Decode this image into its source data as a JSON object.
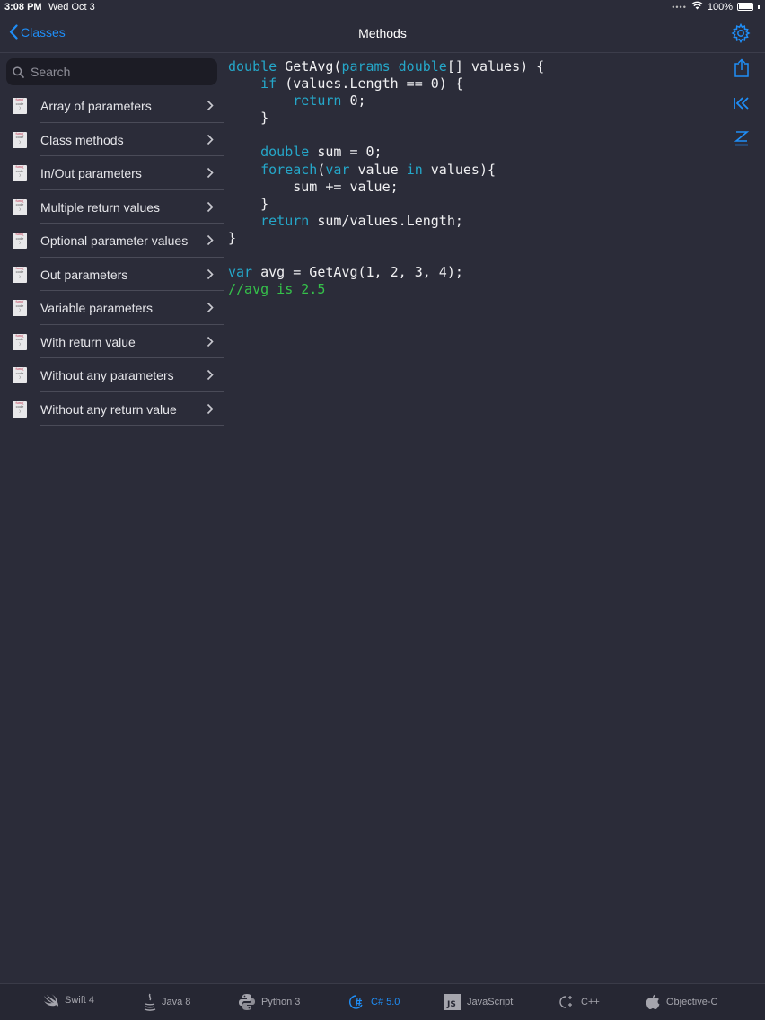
{
  "status": {
    "time": "3:08 PM",
    "date": "Wed Oct 3",
    "battery": "100%"
  },
  "nav": {
    "back_label": "Classes",
    "title": "Methods"
  },
  "search": {
    "placeholder": "Search"
  },
  "sidebar": {
    "items": [
      {
        "label": "Array of parameters"
      },
      {
        "label": "Class methods"
      },
      {
        "label": "In/Out parameters"
      },
      {
        "label": "Multiple return values"
      },
      {
        "label": "Optional parameter values"
      },
      {
        "label": "Out parameters"
      },
      {
        "label": "Variable parameters"
      },
      {
        "label": "With return value"
      },
      {
        "label": "Without any parameters"
      },
      {
        "label": "Without any return value"
      }
    ]
  },
  "file_icon_text": [
    "func(",
    "code",
    ")"
  ],
  "code": {
    "lines": [
      [
        {
          "t": "double",
          "k": "kw"
        },
        {
          "t": " GetAvg("
        },
        {
          "t": "params",
          "k": "kw"
        },
        {
          "t": " "
        },
        {
          "t": "double",
          "k": "kw"
        },
        {
          "t": "[] values) {"
        }
      ],
      [
        {
          "t": "    "
        },
        {
          "t": "if",
          "k": "kw"
        },
        {
          "t": " (values.Length == 0) {"
        }
      ],
      [
        {
          "t": "        "
        },
        {
          "t": "return",
          "k": "kw"
        },
        {
          "t": " 0;"
        }
      ],
      [
        {
          "t": "    }"
        }
      ],
      [
        {
          "t": ""
        }
      ],
      [
        {
          "t": "    "
        },
        {
          "t": "double",
          "k": "kw"
        },
        {
          "t": " sum = 0;"
        }
      ],
      [
        {
          "t": "    "
        },
        {
          "t": "foreach",
          "k": "kw"
        },
        {
          "t": "("
        },
        {
          "t": "var",
          "k": "kw"
        },
        {
          "t": " value "
        },
        {
          "t": "in",
          "k": "kw"
        },
        {
          "t": " values){"
        }
      ],
      [
        {
          "t": "        sum += value;"
        }
      ],
      [
        {
          "t": "    }"
        }
      ],
      [
        {
          "t": "    "
        },
        {
          "t": "return",
          "k": "kw"
        },
        {
          "t": " sum/values.Length;"
        }
      ],
      [
        {
          "t": "}"
        }
      ],
      [
        {
          "t": ""
        }
      ],
      [
        {
          "t": "var",
          "k": "kw"
        },
        {
          "t": " avg = GetAvg(1, 2, 3, 4);"
        }
      ],
      [
        {
          "t": "//avg is 2.5",
          "k": "cm"
        }
      ]
    ]
  },
  "tabs": [
    {
      "label": "Swift 4",
      "icon": "swift-icon"
    },
    {
      "label": "Java 8",
      "icon": "java-icon"
    },
    {
      "label": "Python 3",
      "icon": "python-icon"
    },
    {
      "label": "C# 5.0",
      "icon": "csharp-icon",
      "active": true
    },
    {
      "label": "JavaScript",
      "icon": "javascript-icon"
    },
    {
      "label": "C++",
      "icon": "cpp-icon"
    },
    {
      "label": "Objective-C",
      "icon": "apple-icon"
    }
  ],
  "colors": {
    "accent": "#1f8ef7",
    "background": "#2b2c39",
    "keyword": "#25a7c9",
    "comment": "#35c14a"
  }
}
